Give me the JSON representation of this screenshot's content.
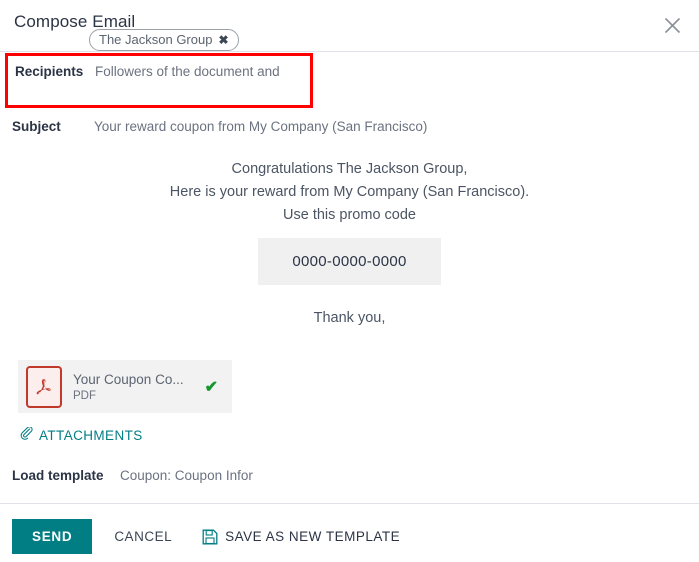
{
  "header": {
    "title": "Compose Email",
    "close_icon": "close-icon"
  },
  "form": {
    "recipients": {
      "label": "Recipients",
      "value": "Followers of the document and",
      "tag": {
        "label": "The Jackson Group",
        "remove_glyph": "✖"
      },
      "highlight_color": "#ff0000"
    },
    "subject": {
      "label": "Subject",
      "value": "Your reward coupon from My Company (San Francisco)"
    }
  },
  "body": {
    "lines": [
      "Congratulations The Jackson Group,",
      "Here is your reward from My Company (San Francisco).",
      "Use this promo code"
    ],
    "promo_code": "0000-0000-0000",
    "closing": "Thank you,"
  },
  "attachment": {
    "name": "Your Coupon Co...",
    "type": "PDF",
    "status_glyph": "✔",
    "status_color": "#17962f",
    "icon": "pdf-file-icon"
  },
  "attachments_link": {
    "label": "ATTACHMENTS",
    "icon": "paperclip-icon",
    "color": "#017e84"
  },
  "load_template": {
    "label": "Load template",
    "value": "Coupon: Coupon Infor"
  },
  "footer": {
    "send_label": "SEND",
    "send_color": "#017e84",
    "cancel_label": "CANCEL",
    "save_template_label": "SAVE AS NEW TEMPLATE",
    "save_icon": "floppy-disk-icon"
  }
}
